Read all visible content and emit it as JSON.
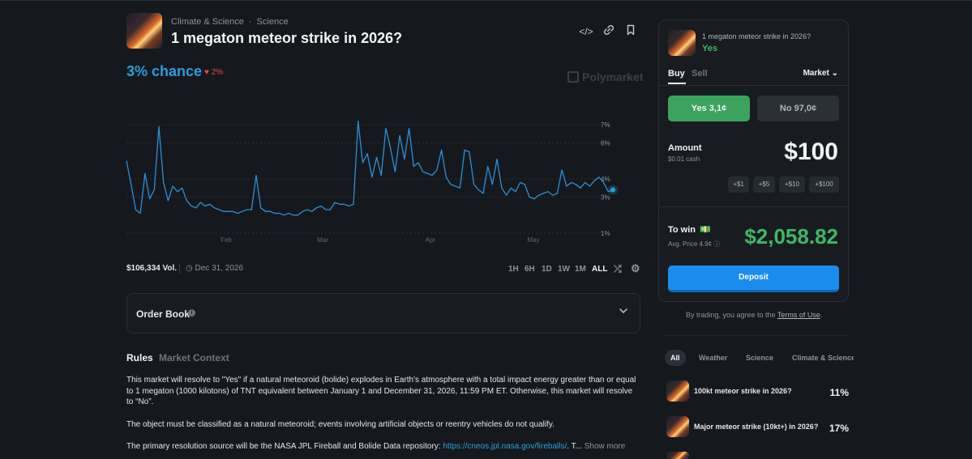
{
  "header": {
    "category": "Climate & Science",
    "subcategory": "Science",
    "title": "1 megaton meteor strike in 2026?",
    "icons": [
      "embed-icon",
      "link-icon",
      "bookmark-icon"
    ]
  },
  "market": {
    "chance": "3% chance",
    "delta": "♥ 2%",
    "watermark": "Polymarket",
    "volume": "$106,334 Vol.",
    "end_date": "Dec 31, 2026",
    "ranges": [
      "1H",
      "6H",
      "1D",
      "1W",
      "1M",
      "ALL"
    ],
    "active_range": "ALL"
  },
  "chart_data": {
    "type": "line",
    "x_ticks": [
      "Feb",
      "Mar",
      "Apr",
      "May"
    ],
    "y_ticks": [
      "7%",
      "6%",
      "4%",
      "3%",
      "1%"
    ],
    "ylim": [
      1,
      7.5
    ],
    "series": [
      {
        "values": [
          5,
          3.7,
          2.3,
          2.1,
          4.3,
          2.9,
          3.4,
          6.9,
          3.8,
          2.8,
          3.6,
          3.3,
          3.5,
          2.8,
          2.5,
          2.4,
          2.7,
          2.5,
          2.6,
          2.4,
          2.3,
          2.2,
          2.2,
          2.2,
          2.1,
          2.2,
          2.3,
          2.3,
          4.2,
          2.4,
          2.2,
          2.2,
          2.1,
          2.1,
          2,
          2.1,
          2,
          2,
          2.2,
          2.3,
          2.2,
          2.4,
          2.5,
          2.3,
          2.3,
          2.7,
          2.6,
          2.6,
          2.5,
          2.6,
          7.2,
          4.9,
          5.4,
          4.1,
          5.2,
          4.2,
          6.8,
          5.7,
          4.4,
          6.4,
          5.1,
          6.8,
          4.7,
          4.9,
          4.4,
          4.3,
          4.2,
          4.5,
          5.6,
          4.1,
          3.7,
          3.6,
          3.5,
          5.6,
          5.5,
          3.7,
          3.4,
          3.2,
          4.7,
          3.7,
          5.1,
          3.5,
          3.1,
          3.5,
          3.3,
          3.8,
          3.7,
          3,
          2.9,
          3.1,
          3.2,
          3.3,
          3.1,
          3.2,
          4.5,
          3.6,
          3.8,
          3.7,
          3.5,
          3.8,
          3.6,
          3.9,
          4.1,
          3.8,
          3.3,
          3.4
        ]
      }
    ],
    "grid": true,
    "current_value": 3.4
  },
  "orderbook": {
    "title": "Order Book"
  },
  "rules": {
    "tabs": [
      "Rules",
      "Market Context"
    ],
    "p1": "This market will resolve to \"Yes\" if a natural meteoroid (bolide) explodes in Earth's atmosphere with a total impact energy greater than or equal to 1 megaton (1000 kilotons) of TNT equivalent between January 1 and December 31, 2026, 11:59 PM ET. Otherwise, this market will resolve to “No”.",
    "p2": "The object must be classified as a natural meteoroid; events involving artificial objects or reentry vehicles do not qualify.",
    "p3_prefix": "The primary resolution source will be the NASA JPL Fireball and Bolide Data repository: ",
    "p3_link": "https://cneos.jpl.nasa.gov/fireballs/",
    "p3_suffix": ". T...",
    "show_more": "Show more"
  },
  "trade": {
    "question": "1 megaton meteor strike in 2026?",
    "outcome": "Yes",
    "buy": "Buy",
    "sell": "Sell",
    "order_type": "Market",
    "yes_btn": "Yes 3,1¢",
    "no_btn": "No 97,0¢",
    "amount_label": "Amount",
    "cash": "$0.01 cash",
    "amount": "$100",
    "chips": [
      "+$1",
      "+$5",
      "+$10",
      "+$100"
    ],
    "to_win_label": "To win",
    "to_win_emoji": "💵",
    "avg_price": "Avg. Price 4.9¢ ⓘ",
    "to_win": "$2,058.82",
    "deposit": "Deposit",
    "terms_prefix": "By trading, you agree to the ",
    "terms_link": "Terms of Use",
    "terms_suffix": "."
  },
  "related": {
    "tabs": [
      "All",
      "Weather",
      "Science",
      "Climate & Science"
    ],
    "items": [
      {
        "title": "100kt meteor strike in 2026?",
        "pct": "11%"
      },
      {
        "title": "Major meteor strike (10kt+) in 2026?",
        "pct": "17%"
      }
    ]
  },
  "colors": {
    "accent_blue": "#2d9cdb",
    "green": "#3aa45c",
    "red": "#e64c4c",
    "bg": "#15191d"
  }
}
